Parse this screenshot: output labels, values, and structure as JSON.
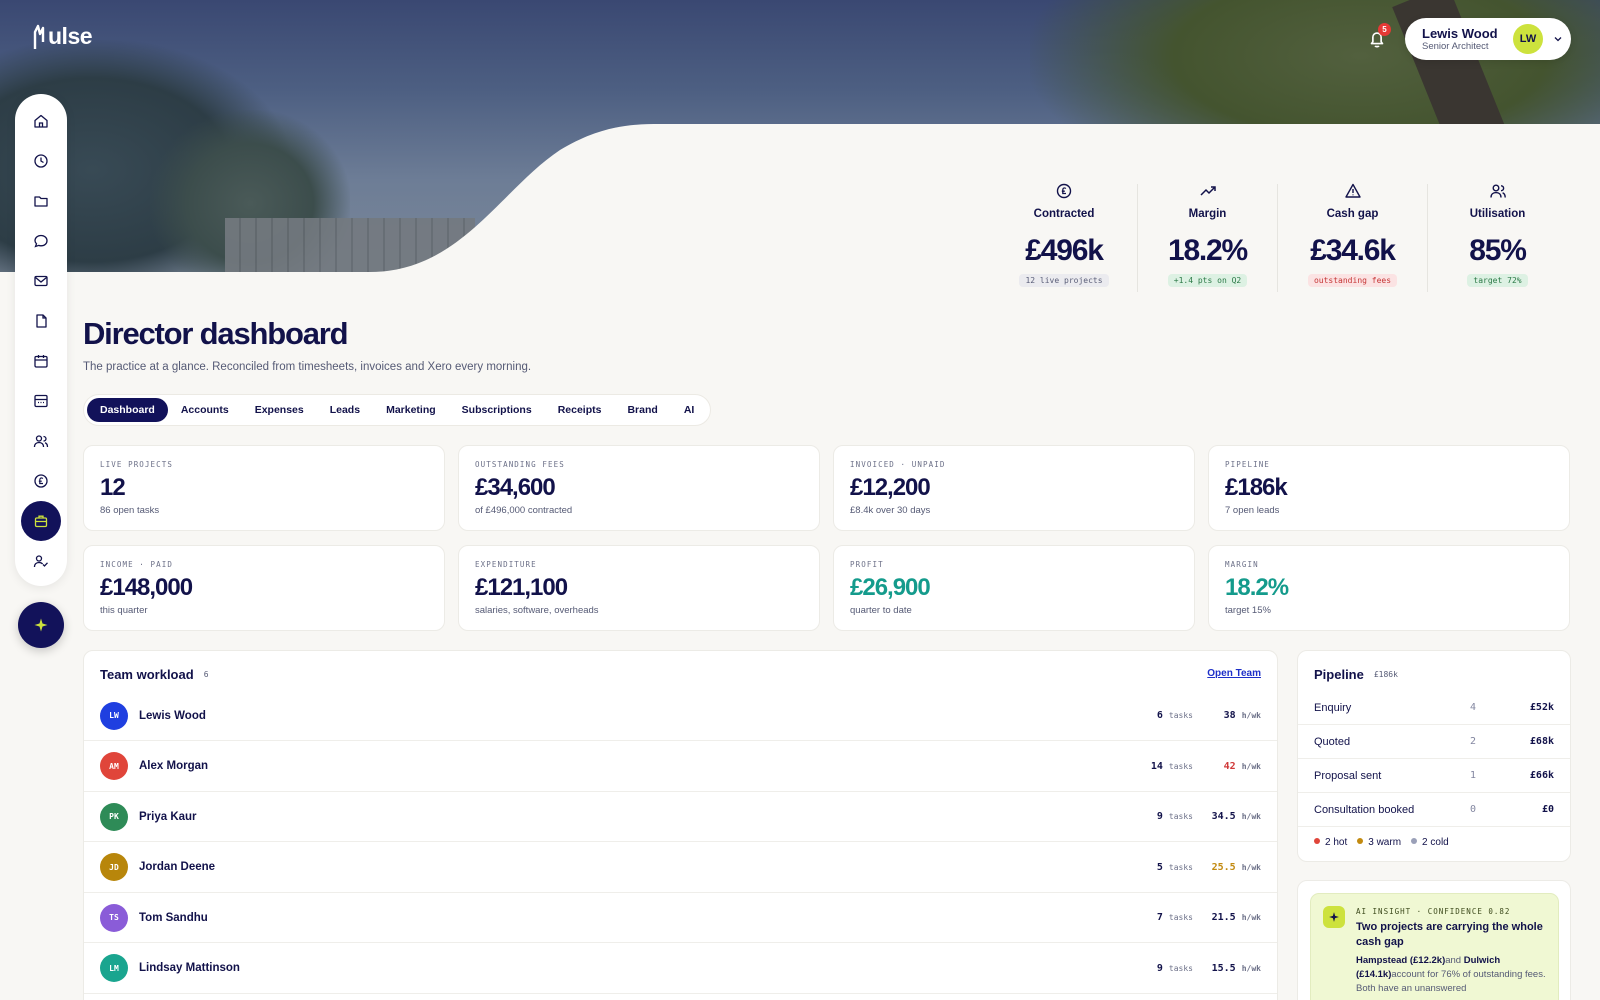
{
  "app": {
    "logo": "ulse"
  },
  "header": {
    "notifications_count": "5",
    "user": {
      "name": "Lewis Wood",
      "role": "Senior Architect",
      "initials": "LW"
    }
  },
  "sidebar": {
    "icons": [
      "home-icon",
      "clock-icon",
      "folder-icon",
      "chat-icon",
      "mail-icon",
      "document-icon",
      "calendar-icon",
      "calculator-icon",
      "users-icon",
      "currency-icon",
      "briefcase-icon",
      "user-check-icon"
    ],
    "active": "briefcase-icon",
    "ai_button": "sparkle-icon"
  },
  "kpis": [
    {
      "label": "Contracted",
      "value": "£496k",
      "note": "12 live projects",
      "icon": "currency-icon",
      "tone": "grey"
    },
    {
      "label": "Margin",
      "value": "18.2%",
      "note": "+1.4 pts on Q2",
      "icon": "trend-up-icon",
      "tone": "green"
    },
    {
      "label": "Cash gap",
      "value": "£34.6k",
      "note": "outstanding fees",
      "icon": "warning-icon",
      "tone": "red"
    },
    {
      "label": "Utilisation",
      "value": "85%",
      "note": "target 72%",
      "icon": "users-icon",
      "tone": "green"
    }
  ],
  "page": {
    "title": "Director dashboard",
    "subtitle": "The practice at a glance. Reconciled from timesheets, invoices and Xero every morning."
  },
  "tabs": [
    "Dashboard",
    "Accounts",
    "Expenses",
    "Leads",
    "Marketing",
    "Subscriptions",
    "Receipts",
    "Brand",
    "AI"
  ],
  "active_tab": "Dashboard",
  "stats": [
    {
      "label": "LIVE PROJECTS",
      "value": "12",
      "sub": "86 open tasks"
    },
    {
      "label": "OUTSTANDING FEES",
      "value": "£34,600",
      "sub": "of £496,000 contracted"
    },
    {
      "label": "INVOICED · UNPAID",
      "value": "£12,200",
      "sub": "£8.4k over 30 days"
    },
    {
      "label": "PIPELINE",
      "value": "£186k",
      "sub": "7 open leads"
    },
    {
      "label": "INCOME · PAID",
      "value": "£148,000",
      "sub": "this quarter"
    },
    {
      "label": "EXPENDITURE",
      "value": "£121,100",
      "sub": "salaries, software, overheads"
    },
    {
      "label": "PROFIT",
      "value": "£26,900",
      "sub": "quarter to date",
      "accent": "#149b8c"
    },
    {
      "label": "MARGIN",
      "value": "18.2%",
      "sub": "target 15%",
      "accent": "#149b8c"
    }
  ],
  "team": {
    "title": "Team workload",
    "count": "6",
    "link": "Open Team",
    "tasks_unit": "tasks",
    "hours_unit": "h/wk",
    "members": [
      {
        "initials": "LW",
        "name": "Lewis Wood",
        "tasks": "6",
        "hours": "38",
        "color": "#1f3fe0",
        "hours_color": "#12124a"
      },
      {
        "initials": "AM",
        "name": "Alex Morgan",
        "tasks": "14",
        "hours": "42",
        "color": "#e0453a",
        "hours_color": "#d03a3a"
      },
      {
        "initials": "PK",
        "name": "Priya Kaur",
        "tasks": "9",
        "hours": "34.5",
        "color": "#2e8b57",
        "hours_color": "#12124a"
      },
      {
        "initials": "JD",
        "name": "Jordan Deene",
        "tasks": "5",
        "hours": "25.5",
        "color": "#b8860b",
        "hours_color": "#c28a10"
      },
      {
        "initials": "TS",
        "name": "Tom Sandhu",
        "tasks": "7",
        "hours": "21.5",
        "color": "#8a5cd8",
        "hours_color": "#12124a"
      },
      {
        "initials": "LM",
        "name": "Lindsay Mattinson",
        "tasks": "9",
        "hours": "15.5",
        "color": "#1aa58f",
        "hours_color": "#12124a"
      }
    ]
  },
  "pipeline": {
    "title": "Pipeline",
    "total": "£186k",
    "stages": [
      {
        "label": "Enquiry",
        "count": "4",
        "value": "£52k"
      },
      {
        "label": "Quoted",
        "count": "2",
        "value": "£68k"
      },
      {
        "label": "Proposal sent",
        "count": "1",
        "value": "£66k"
      },
      {
        "label": "Consultation booked",
        "count": "0",
        "value": "£0"
      }
    ],
    "legend": [
      {
        "label": "2 hot",
        "color": "#e0453a"
      },
      {
        "label": "3 warm",
        "color": "#c28a10"
      },
      {
        "label": "2 cold",
        "color": "#9aa0b8"
      }
    ]
  },
  "insight": {
    "label": "AI INSIGHT · CONFIDENCE 0.82",
    "title": "Two projects are carrying the whole cash gap",
    "body_bold_1": "Hampstead (£12.2k)",
    "body_mid": "and ",
    "body_bold_2": "Dulwich (£14.1k)",
    "body_end": "account for 76% of outstanding fees. Both have an unanswered"
  }
}
